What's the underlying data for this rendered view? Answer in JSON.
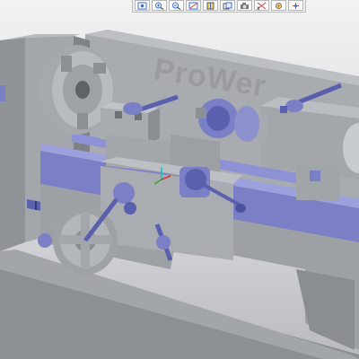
{
  "toolbar": {
    "buttons": [
      {
        "icon": "zoom-fit-icon"
      },
      {
        "icon": "zoom-in-icon"
      },
      {
        "icon": "zoom-out-icon"
      },
      {
        "icon": "repaint-icon"
      },
      {
        "icon": "orient-icon"
      },
      {
        "icon": "saved-views-icon"
      },
      {
        "icon": "display-style-icon"
      },
      {
        "icon": "datum-planes-icon"
      },
      {
        "icon": "datum-points-icon"
      },
      {
        "icon": "spin-center-icon"
      }
    ]
  },
  "model": {
    "watermark_text": "ProWer",
    "colors": {
      "body": "#9a9ea2",
      "body_dark": "#6e7275",
      "accent": "#7a7fc6",
      "accent_dark": "#4d52a0",
      "background": "#d6d6da"
    }
  }
}
